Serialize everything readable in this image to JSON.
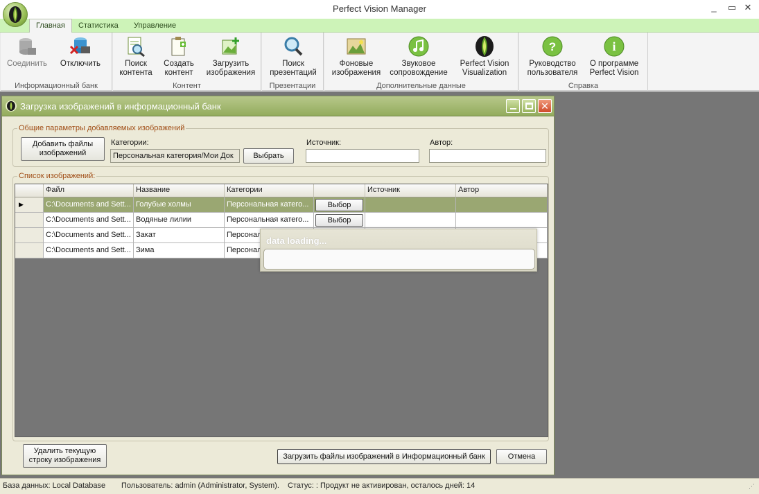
{
  "app": {
    "title": "Perfect Vision Manager"
  },
  "tabs": [
    {
      "label": "Главная",
      "active": true
    },
    {
      "label": "Статистика"
    },
    {
      "label": "Управление"
    }
  ],
  "ribbon": {
    "groups": [
      {
        "label": "Информационный банк",
        "buttons": [
          {
            "label": "Соединить",
            "icon": "database-connect-icon",
            "disabled": true
          },
          {
            "label": "Отключить",
            "icon": "database-disconnect-icon"
          }
        ]
      },
      {
        "label": "Контент",
        "buttons": [
          {
            "label": "Поиск контента",
            "icon": "document-search-icon"
          },
          {
            "label": "Создать контент",
            "icon": "clipboard-create-icon"
          },
          {
            "label": "Загрузить изображения",
            "icon": "image-upload-icon"
          }
        ]
      },
      {
        "label": "Презентации",
        "buttons": [
          {
            "label": "Поиск презентаций",
            "icon": "magnifier-icon"
          }
        ]
      },
      {
        "label": "Дополнительные данные",
        "buttons": [
          {
            "label": "Фоновые изображения",
            "icon": "background-image-icon"
          },
          {
            "label": "Звуковое сопровождение",
            "icon": "music-note-icon"
          },
          {
            "label": "Perfect Vision Visualization",
            "icon": "eye-logo-icon"
          }
        ]
      },
      {
        "label": "Справка",
        "buttons": [
          {
            "label": "Руководство пользователя",
            "icon": "help-icon"
          },
          {
            "label": "О программе Perfect Vision",
            "icon": "info-icon"
          }
        ]
      }
    ]
  },
  "dialog": {
    "title": "Загрузка изображений в информационный банк",
    "params_legend": "Общие параметры добавляемых изображений",
    "add_files_label": "Добавить файлы изображений",
    "categories_label": "Категории:",
    "categories_value": "Персональная категория/Мои Док",
    "choose_label": "Выбрать",
    "source_label": "Источник:",
    "source_value": "",
    "author_label": "Автор:",
    "author_value": "",
    "list_legend": "Список изображений:",
    "columns": [
      "Файл",
      "Название",
      "Категории",
      "",
      "Источник",
      "Автор"
    ],
    "rows": [
      {
        "file": "C:\\Documents and Sett...",
        "name": "Голубые холмы",
        "category": "Персональная катего...",
        "action": "Выбор",
        "source": "",
        "author": ""
      },
      {
        "file": "C:\\Documents and Sett...",
        "name": "Водяные лилии",
        "category": "Персональная катего...",
        "action": "Выбор",
        "source": "",
        "author": ""
      },
      {
        "file": "C:\\Documents and Sett...",
        "name": "Закат",
        "category": "Персональ",
        "action": "",
        "source": "",
        "author": ""
      },
      {
        "file": "C:\\Documents and Sett...",
        "name": "Зима",
        "category": "Персональ",
        "action": "",
        "source": "",
        "author": ""
      }
    ],
    "delete_row_label": "Удалить текущую строку изображения",
    "upload_label": "Загрузить файлы изображений в Информационный банк",
    "cancel_label": "Отмена"
  },
  "loading": {
    "text": "data loading..."
  },
  "status": {
    "database": "База данных: Local Database",
    "user": "Пользователь: admin (Administrator, System).",
    "state": "Статус: : Продукт не активирован, осталось дней: 14"
  },
  "colors": {
    "accent": "#9aa772",
    "tab_bar": "#cdf3b8",
    "workspace": "#767676",
    "legend": "#a04d16"
  }
}
